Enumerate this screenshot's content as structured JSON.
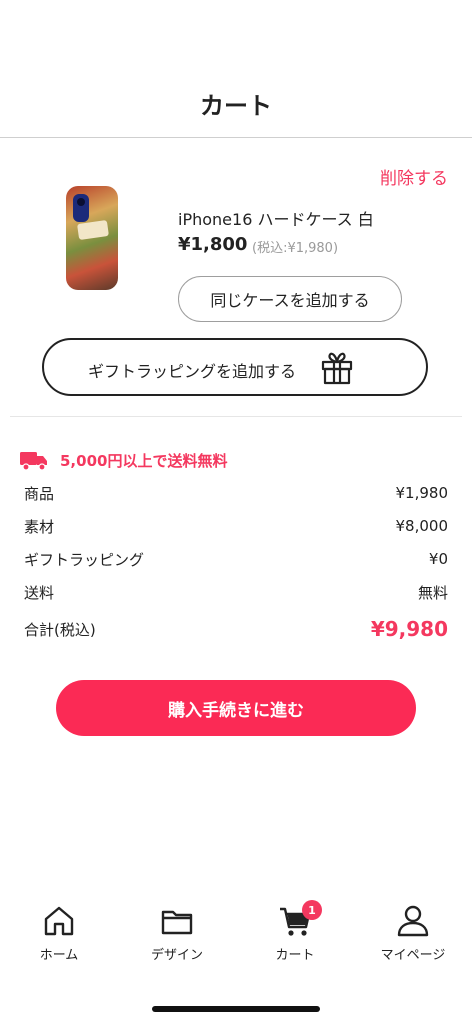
{
  "header": {
    "title": "カート"
  },
  "item": {
    "delete_label": "削除する",
    "name": "iPhone16 ハードケース 白",
    "price": "¥1,800",
    "price_tax": "(税込:¥1,980)",
    "add_same_label": "同じケースを追加する"
  },
  "gift": {
    "label": "ギフトラッピングを追加する",
    "icon": "gift-icon"
  },
  "shipping_notice": {
    "text": "5,000円以上で送料無料",
    "icon": "truck-icon"
  },
  "summary": {
    "rows": [
      {
        "label": "商品",
        "value": "¥1,980"
      },
      {
        "label": "素材",
        "value": "¥8,000"
      },
      {
        "label": "ギフトラッピング",
        "value": "¥0"
      },
      {
        "label": "送料",
        "value": "無料"
      }
    ],
    "total_label": "合計(税込)",
    "total_value": "¥9,980"
  },
  "checkout_label": "購入手続きに進む",
  "tabbar": {
    "items": [
      {
        "label": "ホーム",
        "icon": "home-icon"
      },
      {
        "label": "デザイン",
        "icon": "folder-icon"
      },
      {
        "label": "カート",
        "icon": "cart-icon",
        "badge": "1"
      },
      {
        "label": "マイページ",
        "icon": "user-icon"
      }
    ]
  },
  "colors": {
    "accent": "#f4385f",
    "button": "#fb2a55",
    "text": "#222222",
    "muted": "#9a9a9a"
  }
}
